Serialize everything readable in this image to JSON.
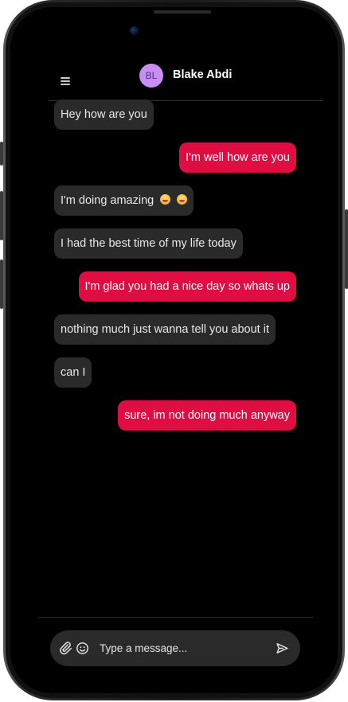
{
  "conversation": {
    "contact_initials": "BL",
    "contact_name": "Blake Abdi"
  },
  "messages": [
    {
      "direction": "in",
      "text": "Hey how are you"
    },
    {
      "direction": "out",
      "text": "I'm well how are you"
    },
    {
      "direction": "in",
      "text": "I'm doing amazing",
      "emoji": [
        "grinning-face-emoji",
        "grinning-face-emoji"
      ]
    },
    {
      "direction": "in",
      "text": "I had the best time of my life today"
    },
    {
      "direction": "out",
      "text": "I'm glad you had a nice day so whats up"
    },
    {
      "direction": "in",
      "text": "nothing much just wanna tell you about it"
    },
    {
      "direction": "in",
      "text": "can I"
    },
    {
      "direction": "out",
      "text": "sure, im not doing much anyway"
    }
  ],
  "composer": {
    "placeholder": "Type a message...",
    "value": ""
  },
  "icons": {
    "menu": "hamburger-menu-icon",
    "attach": "paperclip-icon",
    "emoji": "smiley-icon",
    "send": "send-icon"
  },
  "colors": {
    "screen_bg": "#000000",
    "incoming_bubble": "#2a2a2a",
    "outgoing_bubble": "#e00d42",
    "avatar_bg": "#c98ef2",
    "avatar_text": "#5b2a86"
  }
}
